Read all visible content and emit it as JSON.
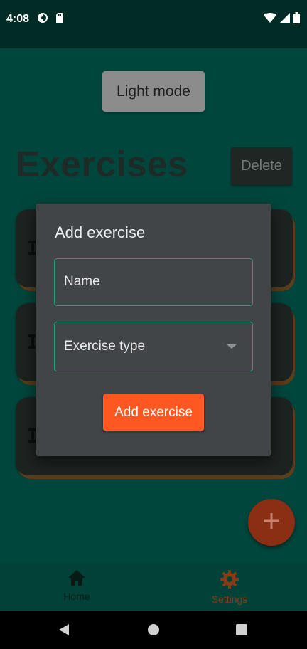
{
  "status_bar": {
    "time": "4:08",
    "left_icons": [
      "data-saver-icon",
      "sd-card-icon"
    ],
    "right_icons": [
      "wifi-icon",
      "signal-icon",
      "battery-icon"
    ]
  },
  "settings": {
    "light_mode_label": "Light mode"
  },
  "page": {
    "title": "Exercises",
    "delete_label": "Delete"
  },
  "cards": [
    {
      "icon": "dumbbell-icon"
    },
    {
      "icon": "dumbbell-icon"
    },
    {
      "icon": "dumbbell-icon"
    }
  ],
  "fab": {
    "icon": "plus-icon"
  },
  "bottom_nav": {
    "items": [
      {
        "label": "Home",
        "icon": "home-icon"
      },
      {
        "label": "Settings",
        "icon": "gear-icon"
      }
    ]
  },
  "dialog": {
    "title": "Add exercise",
    "name_placeholder": "Name",
    "type_placeholder": "Exercise type",
    "submit_label": "Add exercise"
  },
  "colors": {
    "accent": "#ff5722",
    "field_border": "#1aa082",
    "dialog_bg": "#424548",
    "app_bg": "#00463c"
  }
}
